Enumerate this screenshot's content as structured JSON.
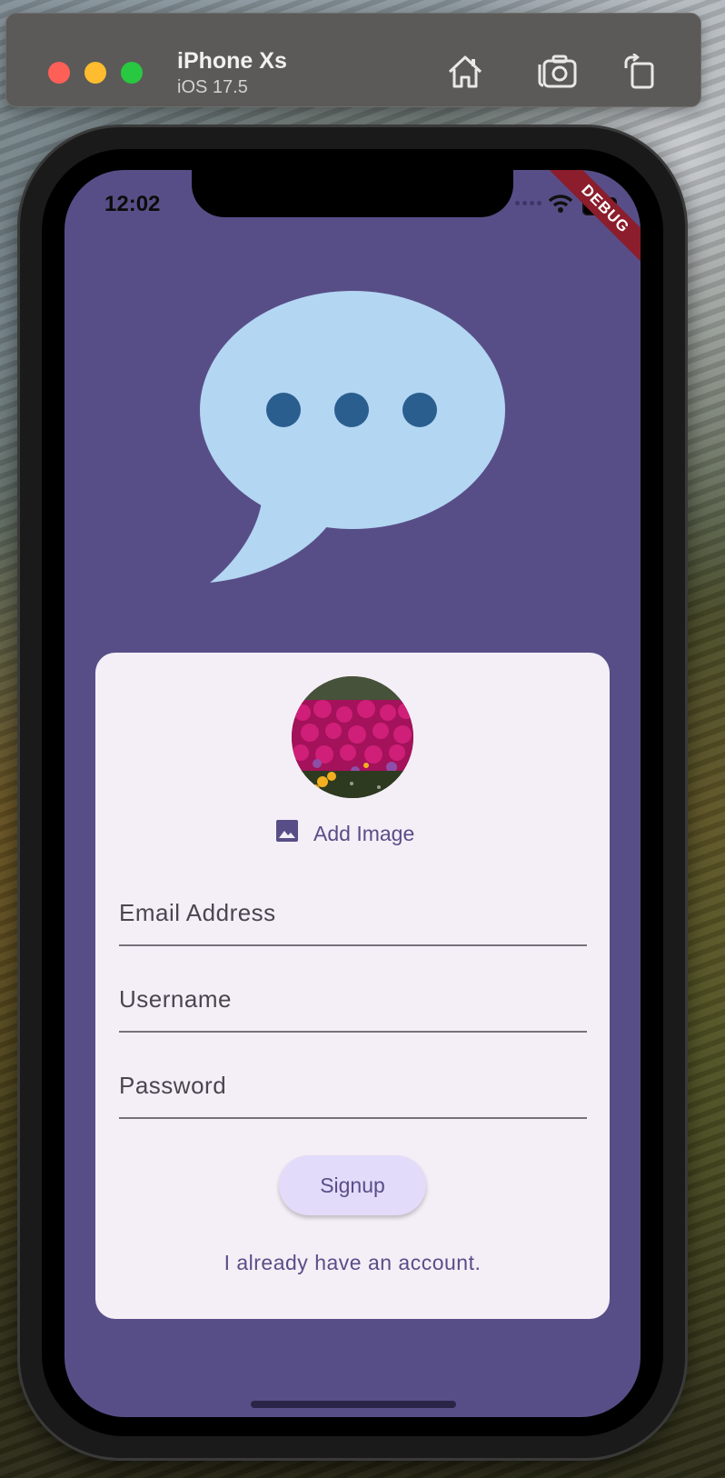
{
  "simulator": {
    "device_name": "iPhone Xs",
    "os_version": "iOS 17.5",
    "toolbar_icons": [
      "home-icon",
      "screenshot-icon",
      "rotate-icon"
    ]
  },
  "status_bar": {
    "time": "12:02",
    "icons": [
      "cellular-icon",
      "wifi-icon",
      "battery-icon"
    ]
  },
  "debug_banner": "DEBUG",
  "logo": {
    "icon": "chat-bubble-icon",
    "bubble_color": "#b3d6f3",
    "dot_color": "#2a5e8e"
  },
  "form": {
    "avatar_alt": "flower-photo",
    "add_image_label": "Add Image",
    "add_image_icon": "image-icon",
    "email_placeholder": "Email Address",
    "username_placeholder": "Username",
    "password_placeholder": "Password",
    "signup_label": "Signup",
    "login_link": "I already have an account."
  },
  "colors": {
    "background": "#584e87",
    "card": "#f4eff7",
    "accent": "#584e87",
    "button": "#e3dbfa"
  }
}
